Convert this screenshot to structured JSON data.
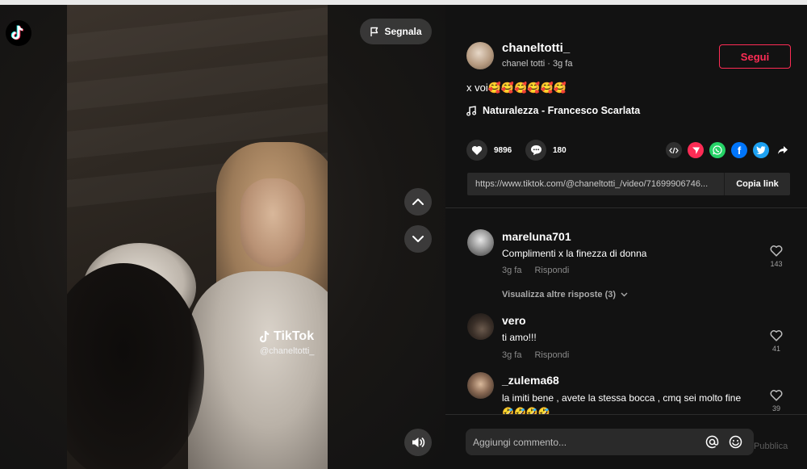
{
  "report": {
    "label": "Segnala"
  },
  "watermark": {
    "brand": "TikTok",
    "user": "@chaneltotti_"
  },
  "author": {
    "username": "chaneltotti_",
    "subtitle": "chanel totti · 3g fa",
    "follow_label": "Segui",
    "caption": "x voi🥰🥰🥰🥰🥰🥰",
    "music": "Naturalezza - Francesco Scarlata"
  },
  "stats": {
    "likes": "9896",
    "comments": "180"
  },
  "share": {
    "link": "https://www.tiktok.com/@chaneltotti_/video/71699906746...",
    "copy_label": "Copia link",
    "colors": {
      "embed": "#2f2f2f",
      "tiktok": "#fe2c55",
      "whatsapp": "#25d366",
      "facebook": "#0075fa",
      "twitter": "#1da1f2"
    }
  },
  "comments": [
    {
      "user": "mareluna701",
      "text": "Complimenti x la finezza di donna",
      "time": "3g fa",
      "reply_label": "Rispondi",
      "likes": "143",
      "view_replies": "Visualizza altre risposte (3)"
    },
    {
      "user": "vero",
      "text": "ti amo!!!",
      "time": "3g fa",
      "reply_label": "Rispondi",
      "likes": "41"
    },
    {
      "user": "_zulema68",
      "text": "la imiti bene , avete la stessa bocca , cmq sei molto fine 🤣🤣🤣🤣",
      "likes": "39"
    }
  ],
  "input": {
    "placeholder": "Aggiungi commento...",
    "publish_label": "Pubblica"
  },
  "colors": {
    "accent": "#fe2c55",
    "background": "#121212"
  }
}
